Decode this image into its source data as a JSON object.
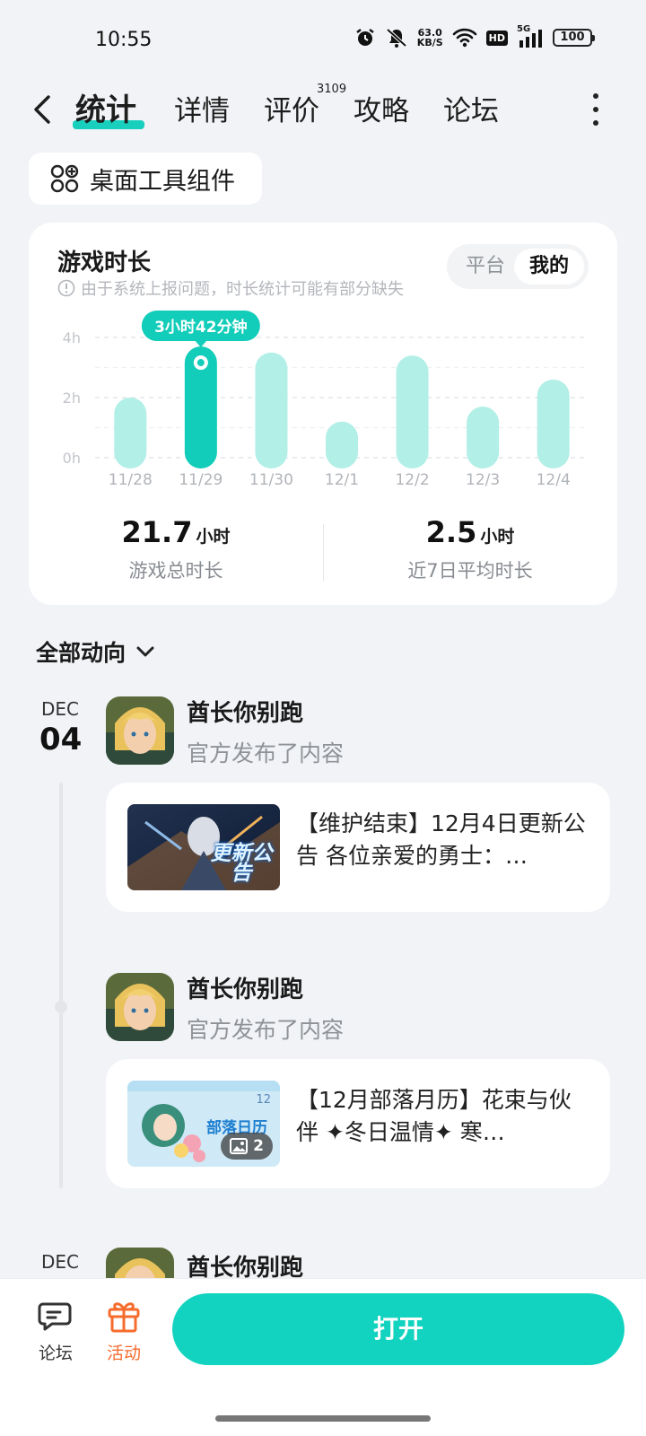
{
  "status": {
    "time": "10:55",
    "net_speed": "63.0",
    "net_unit": "KB/S",
    "hd": "HD",
    "signal": "5G",
    "battery": "100"
  },
  "nav": {
    "tabs": [
      {
        "label": "统计",
        "active": true
      },
      {
        "label": "详情"
      },
      {
        "label": "评价",
        "badge": "3109"
      },
      {
        "label": "攻略"
      },
      {
        "label": "论坛"
      }
    ]
  },
  "widget_button": {
    "label": "桌面工具组件"
  },
  "stats": {
    "title": "游戏时长",
    "note": "由于系统上报问题，时长统计可能有部分缺失",
    "toggle": [
      "平台",
      "我的"
    ],
    "active_toggle": "我的",
    "tooltip": "3小时42分钟",
    "total_value": "21.7",
    "total_unit": "小时",
    "total_label": "游戏总时长",
    "avg_value": "2.5",
    "avg_unit": "小时",
    "avg_label": "近7日平均时长"
  },
  "chart_data": {
    "type": "bar",
    "categories": [
      "11/28",
      "11/29",
      "11/30",
      "12/1",
      "12/2",
      "12/3",
      "12/4"
    ],
    "values": [
      2.0,
      3.7,
      3.5,
      1.2,
      3.4,
      1.7,
      2.6
    ],
    "highlight_index": 1,
    "ylim": [
      0,
      4
    ],
    "yticks": [
      "0h",
      "2h",
      "4h"
    ],
    "grid": true,
    "colors": {
      "bar": "#b1efe7",
      "active": "#12cdb9"
    }
  },
  "feed": {
    "filter_label": "全部动向",
    "date_month": "DEC",
    "date_day": "04",
    "posts": [
      {
        "author": "酋长你别跑",
        "action": "官方发布了内容",
        "text": "【维护结束】12月4日更新公告  各位亲爱的勇士：…",
        "thumb_text": "更新公告"
      },
      {
        "author": "酋长你别跑",
        "action": "官方发布了内容",
        "text": "【12月部落月历】花束与伙伴  ✦冬日温情✦  寒…",
        "thumb_text": "部落日历",
        "thumb_corner": "12",
        "image_count": "2"
      }
    ],
    "next": {
      "date_month": "DEC",
      "author": "酋长你别跑"
    }
  },
  "bottom": {
    "forum_label": "论坛",
    "activity_label": "活动",
    "open_label": "打开"
  },
  "colors": {
    "accent": "#12d3bf",
    "activity": "#f56c2d"
  }
}
